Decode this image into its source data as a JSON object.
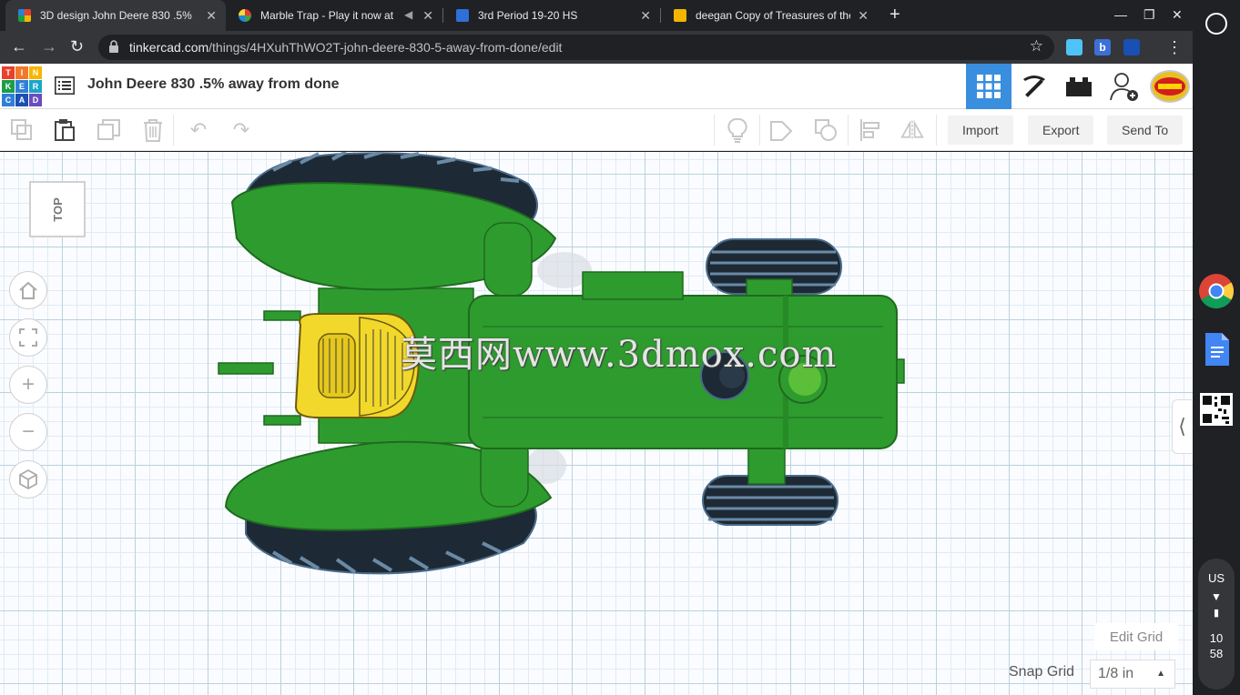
{
  "browser": {
    "tabs": [
      {
        "title": "3D design John Deere 830 .5% a",
        "active": true
      },
      {
        "title": "Marble Trap - Play it now at",
        "active": false
      },
      {
        "title": "3rd Period 19-20 HS",
        "active": false
      },
      {
        "title": "deegan Copy of Treasures of the",
        "active": false
      }
    ],
    "url_host": "tinkercad.com",
    "url_path": "/things/4HXuhThWO2T-john-deere-830-5-away-from-done/edit"
  },
  "header": {
    "logo_letters": [
      "TIN",
      "KER",
      "CAD"
    ],
    "design_title": "John Deere 830 .5% away from done"
  },
  "toolbar": {
    "import_label": "Import",
    "export_label": "Export",
    "sendto_label": "Send To"
  },
  "workplane": {
    "viewcube_label": "TOP",
    "edit_grid_label": "Edit Grid",
    "snap_grid_label": "Snap Grid",
    "snap_grid_value": "1/8 in",
    "watermark": "莫西网www.3dmox.com"
  },
  "shelf": {
    "keyboard": "US",
    "time_hour": "10",
    "time_min": "58"
  },
  "colors": {
    "tractor_green": "#2e9b2e",
    "tractor_yellow": "#f2d82a",
    "tinkercad_blue": "#3a8ede"
  }
}
